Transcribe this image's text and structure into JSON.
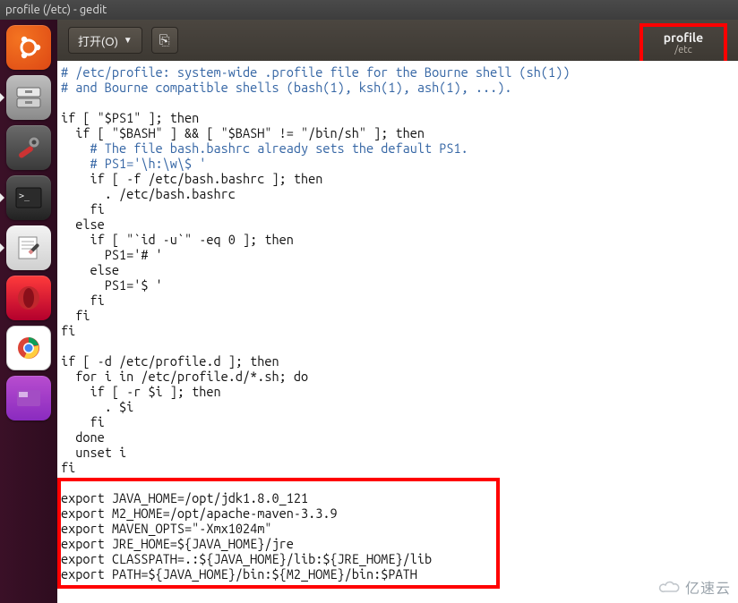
{
  "window": {
    "title": "profile (/etc) - gedit"
  },
  "toolbar": {
    "open_label": "打开(O)",
    "tab_name": "profile",
    "tab_path": "/etc"
  },
  "launcher": {
    "items": [
      {
        "name": "ubuntu-dash"
      },
      {
        "name": "files"
      },
      {
        "name": "settings"
      },
      {
        "name": "terminal"
      },
      {
        "name": "gedit"
      },
      {
        "name": "opera"
      },
      {
        "name": "chrome"
      },
      {
        "name": "desktop-switcher"
      }
    ]
  },
  "code": {
    "l1": "# /etc/profile: system-wide .profile file for the Bourne shell (sh(1))",
    "l2": "# and Bourne compatible shells (bash(1), ksh(1), ash(1), ...).",
    "l3": "",
    "l4": "if [ \"$PS1\" ]; then",
    "l5": "  if [ \"$BASH\" ] && [ \"$BASH\" != \"/bin/sh\" ]; then",
    "l6": "    # The file bash.bashrc already sets the default PS1.",
    "l7": "    # PS1='\\h:\\w\\$ '",
    "l8": "    if [ -f /etc/bash.bashrc ]; then",
    "l9": "      . /etc/bash.bashrc",
    "l10": "    fi",
    "l11": "  else",
    "l12": "    if [ \"`id -u`\" -eq 0 ]; then",
    "l13": "      PS1='# '",
    "l14": "    else",
    "l15": "      PS1='$ '",
    "l16": "    fi",
    "l17": "  fi",
    "l18": "fi",
    "l19": "",
    "l20": "if [ -d /etc/profile.d ]; then",
    "l21": "  for i in /etc/profile.d/*.sh; do",
    "l22": "    if [ -r $i ]; then",
    "l23": "      . $i",
    "l24": "    fi",
    "l25": "  done",
    "l26": "  unset i",
    "l27": "fi",
    "l28": "",
    "l29": "export JAVA_HOME=/opt/jdk1.8.0_121",
    "l30": "export M2_HOME=/opt/apache-maven-3.3.9",
    "l31": "export MAVEN_OPTS=\"-Xmx1024m\"",
    "l32": "export JRE_HOME=${JAVA_HOME}/jre",
    "l33": "export CLASSPATH=.:${JAVA_HOME}/lib:${JRE_HOME}/lib",
    "l34": "export PATH=${JAVA_HOME}/bin:${M2_HOME}/bin:$PATH"
  },
  "watermark": "亿速云"
}
